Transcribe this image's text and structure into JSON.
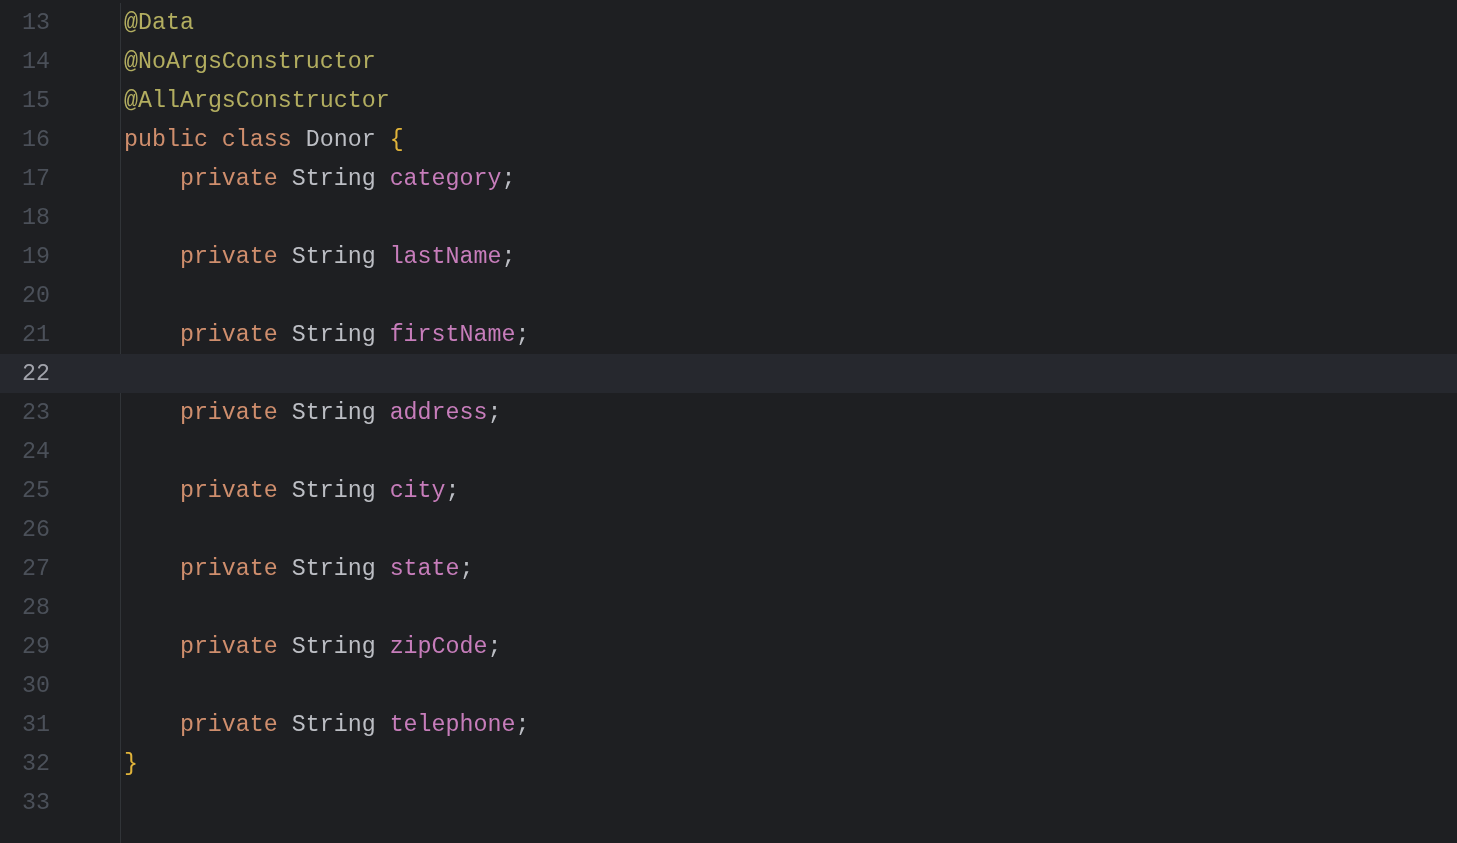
{
  "editor": {
    "lines": [
      {
        "number": "13",
        "selected": false,
        "tokens": [
          {
            "kind": "annotation",
            "text": "@Data"
          }
        ]
      },
      {
        "number": "14",
        "selected": false,
        "tokens": [
          {
            "kind": "annotation",
            "text": "@NoArgsConstructor"
          }
        ]
      },
      {
        "number": "15",
        "selected": false,
        "tokens": [
          {
            "kind": "annotation",
            "text": "@AllArgsConstructor"
          }
        ]
      },
      {
        "number": "16",
        "selected": false,
        "tokens": [
          {
            "kind": "keyword",
            "text": "public class "
          },
          {
            "kind": "plain",
            "text": "Donor "
          },
          {
            "kind": "brace",
            "text": "{"
          }
        ],
        "children": [
          {
            "number": "17",
            "selected": false,
            "tokens": [
              {
                "kind": "keyword",
                "text": "private "
              },
              {
                "kind": "plain",
                "text": "String "
              },
              {
                "kind": "field",
                "text": "category"
              },
              {
                "kind": "plain",
                "text": ";"
              }
            ]
          },
          {
            "number": "18",
            "selected": false
          },
          {
            "number": "19",
            "selected": false,
            "tokens": [
              {
                "kind": "keyword",
                "text": "private "
              },
              {
                "kind": "plain",
                "text": "String "
              },
              {
                "kind": "field",
                "text": "lastName"
              },
              {
                "kind": "plain",
                "text": ";"
              }
            ]
          },
          {
            "number": "20",
            "selected": false
          },
          {
            "number": "21",
            "selected": false,
            "tokens": [
              {
                "kind": "keyword",
                "text": "private "
              },
              {
                "kind": "plain",
                "text": "String "
              },
              {
                "kind": "field",
                "text": "firstName"
              },
              {
                "kind": "plain",
                "text": ";"
              }
            ]
          },
          {
            "number": "22",
            "selected": true
          },
          {
            "number": "23",
            "selected": false,
            "tokens": [
              {
                "kind": "keyword",
                "text": "private "
              },
              {
                "kind": "plain",
                "text": "String "
              },
              {
                "kind": "field",
                "text": "address"
              },
              {
                "kind": "plain",
                "text": ";"
              }
            ]
          },
          {
            "number": "24",
            "selected": false
          },
          {
            "number": "25",
            "selected": false,
            "tokens": [
              {
                "kind": "keyword",
                "text": "private "
              },
              {
                "kind": "plain",
                "text": "String "
              },
              {
                "kind": "field",
                "text": "city"
              },
              {
                "kind": "plain",
                "text": ";"
              }
            ]
          },
          {
            "number": "26",
            "selected": false
          },
          {
            "number": "27",
            "selected": false,
            "tokens": [
              {
                "kind": "keyword",
                "text": "private "
              },
              {
                "kind": "plain",
                "text": "String "
              },
              {
                "kind": "field",
                "text": "state"
              },
              {
                "kind": "plain",
                "text": ";"
              }
            ]
          },
          {
            "number": "28",
            "selected": false
          },
          {
            "number": "29",
            "selected": false,
            "tokens": [
              {
                "kind": "keyword",
                "text": "private "
              },
              {
                "kind": "plain",
                "text": "String "
              },
              {
                "kind": "field",
                "text": "zipCode"
              },
              {
                "kind": "plain",
                "text": ";"
              }
            ]
          },
          {
            "number": "30",
            "selected": false
          },
          {
            "number": "31",
            "selected": false,
            "tokens": [
              {
                "kind": "keyword",
                "text": "private "
              },
              {
                "kind": "plain",
                "text": "String "
              },
              {
                "kind": "field",
                "text": "telephone"
              },
              {
                "kind": "plain",
                "text": ";"
              }
            ]
          }
        ]
      },
      {
        "number": "32",
        "selected": false,
        "tokens": [
          {
            "kind": "brace",
            "text": "}"
          }
        ]
      },
      {
        "number": "33",
        "selected": false
      }
    ]
  }
}
